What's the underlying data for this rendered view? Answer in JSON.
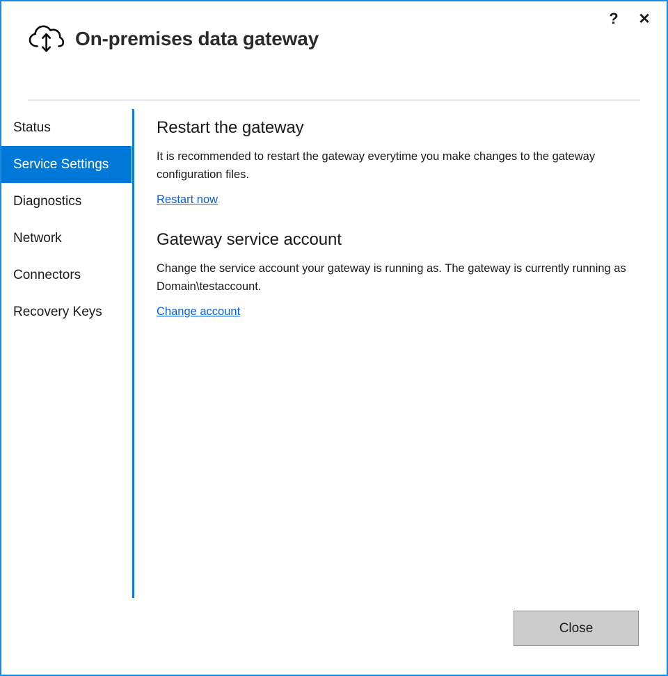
{
  "window": {
    "title": "On-premises data gateway",
    "icon": "cloud-updown-arrow-icon",
    "border_color": "#1a8ae0",
    "help_label": "?",
    "close_label": "✕"
  },
  "sidebar": {
    "accent_color": "#0078d7",
    "items": [
      {
        "label": "Status",
        "selected": false
      },
      {
        "label": "Service Settings",
        "selected": true
      },
      {
        "label": "Diagnostics",
        "selected": false
      },
      {
        "label": "Network",
        "selected": false
      },
      {
        "label": "Connectors",
        "selected": false
      },
      {
        "label": "Recovery Keys",
        "selected": false
      }
    ]
  },
  "main": {
    "sections": [
      {
        "heading": "Restart the gateway",
        "body": "It is recommended to restart the gateway everytime you make changes to the gateway configuration files.",
        "link": "Restart now"
      },
      {
        "heading": "Gateway service account",
        "body": "Change the service account your gateway is running as. The gateway is currently running as Domain\\testaccount.",
        "link": "Change account"
      }
    ],
    "link_color": "#0b5fd6"
  },
  "footer": {
    "close_label": "Close"
  }
}
